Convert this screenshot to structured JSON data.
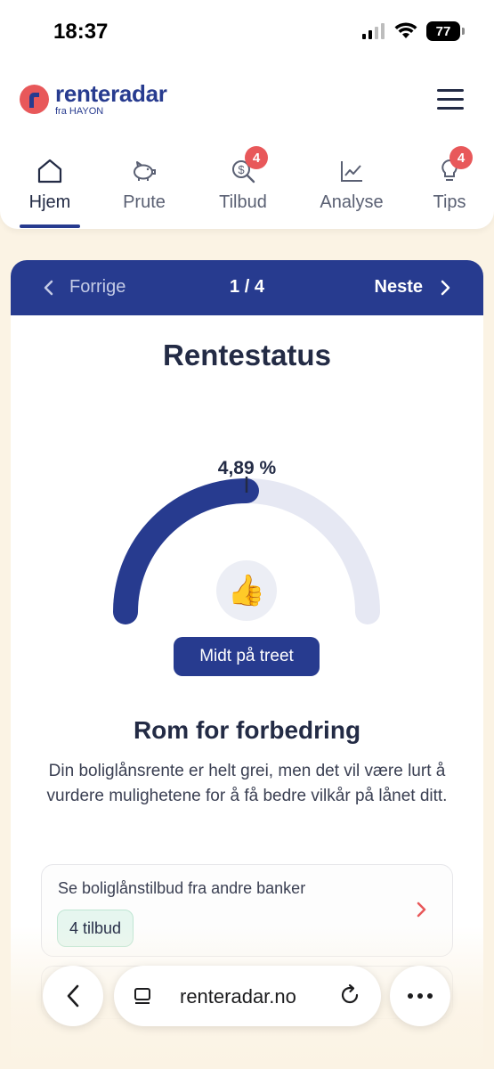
{
  "status_bar": {
    "time": "18:37",
    "battery": "77"
  },
  "header": {
    "brand": "renteradar",
    "tagline": "fra HAYON"
  },
  "nav": {
    "items": [
      {
        "label": "Hjem",
        "icon": "home-icon",
        "active": true
      },
      {
        "label": "Prute",
        "icon": "piggy-bank-icon"
      },
      {
        "label": "Tilbud",
        "icon": "dollar-search-icon",
        "badge": "4"
      },
      {
        "label": "Analyse",
        "icon": "chart-icon"
      },
      {
        "label": "Tips",
        "icon": "lightbulb-icon",
        "badge": "4"
      }
    ]
  },
  "pager": {
    "prev": "Forrige",
    "count": "1 / 4",
    "next": "Neste"
  },
  "rate_status": {
    "title": "Rentestatus",
    "rate": "4,89 %",
    "gauge_level": 0.5,
    "emoji": "👍",
    "status_label": "Midt på treet",
    "heading": "Rom for forbedring",
    "description": "Din boliglånsrente er helt grei, men det vil være lurt å vurdere mulighetene for å få bedre vilkår på lånet ditt."
  },
  "offer": {
    "title": "Se boliglånstilbud fra andre banker",
    "badge": "4 tilbud"
  },
  "browser": {
    "url": "renteradar.no"
  },
  "colors": {
    "brand_blue": "#273b8f",
    "accent_red": "#e8585a",
    "background": "#fbf3e4"
  }
}
